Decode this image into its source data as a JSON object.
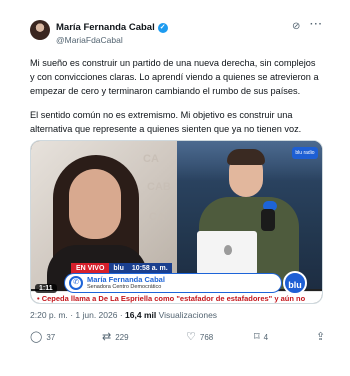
{
  "post": {
    "author_name": "María Fernanda Cabal",
    "handle": "@MariaFdaCabal",
    "paragraph1": "Mi sueño es construir un partido de una nueva derecha, sin complejos y con convicciones claras. Lo aprendí viendo a quienes se atrevieron a empezar de cero y terminaron cambiando el rumbo de sus países.",
    "paragraph2": "El sentido común no es extremismo. Mi objetivo es construir una alternativa que represente a quienes sienten que ya no tienen voz."
  },
  "video": {
    "live_label": "EN VIVO",
    "channel": "blu",
    "time": "10:58 a. m.",
    "guest_name": "María Fernanda Cabal",
    "guest_role": "Senadora Centro Democrático",
    "ticker": "• Cepeda llama a De La Espriella como \"estafador de estafadores\" y aún no",
    "duration": "1:11",
    "logo_text": "blu",
    "corner_logo_text": "blu radio"
  },
  "meta": {
    "time": "2:20 p. m.",
    "date": "1 jun. 2026",
    "views": "16,4 mil",
    "views_label": "Visualizaciones"
  },
  "actions": {
    "replies": "37",
    "reposts": "229",
    "likes": "768",
    "bookmarks": "4"
  },
  "icons": [
    "verified-icon",
    "grok-icon",
    "more-icon",
    "reply-icon",
    "repost-icon",
    "like-icon",
    "bookmark-icon",
    "share-icon",
    "phone-icon"
  ],
  "colors": {
    "accent": "#1d9bf0",
    "live_red": "#d61f2b",
    "channel_blue": "#1d64d8"
  }
}
